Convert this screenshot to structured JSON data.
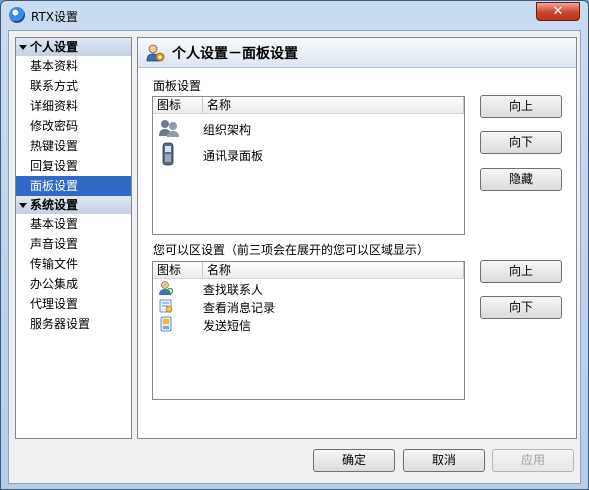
{
  "window": {
    "title": "RTX设置",
    "close": "✕"
  },
  "sidebar": {
    "groups": [
      {
        "label": "个人设置",
        "items": [
          "基本资料",
          "联系方式",
          "详细资料",
          "修改密码",
          "热键设置",
          "回复设置",
          "面板设置"
        ]
      },
      {
        "label": "系统设置",
        "items": [
          "基本设置",
          "声音设置",
          "传输文件",
          "办公集成",
          "代理设置",
          "服务器设置"
        ]
      }
    ],
    "selected": "面板设置"
  },
  "main": {
    "title": "个人设置－面板设置",
    "panel_section": {
      "label": "面板设置",
      "columns": [
        "图标",
        "名称"
      ],
      "rows": [
        {
          "icon": "org-structure-icon",
          "name": "组织架构"
        },
        {
          "icon": "phone-book-icon",
          "name": "通讯录面板"
        }
      ],
      "buttons": {
        "up": "向上",
        "down": "向下",
        "hide": "隐藏"
      }
    },
    "zone_section": {
      "label": "您可以区设置（前三项会在展开的您可以区域显示）",
      "columns": [
        "图标",
        "名称"
      ],
      "rows": [
        {
          "icon": "find-contact-icon",
          "name": "查找联系人"
        },
        {
          "icon": "message-history-icon",
          "name": "查看消息记录"
        },
        {
          "icon": "send-sms-icon",
          "name": "发送短信"
        }
      ],
      "buttons": {
        "up": "向上",
        "down": "向下"
      }
    }
  },
  "footer": {
    "ok": "确定",
    "cancel": "取消",
    "apply": "应用"
  }
}
